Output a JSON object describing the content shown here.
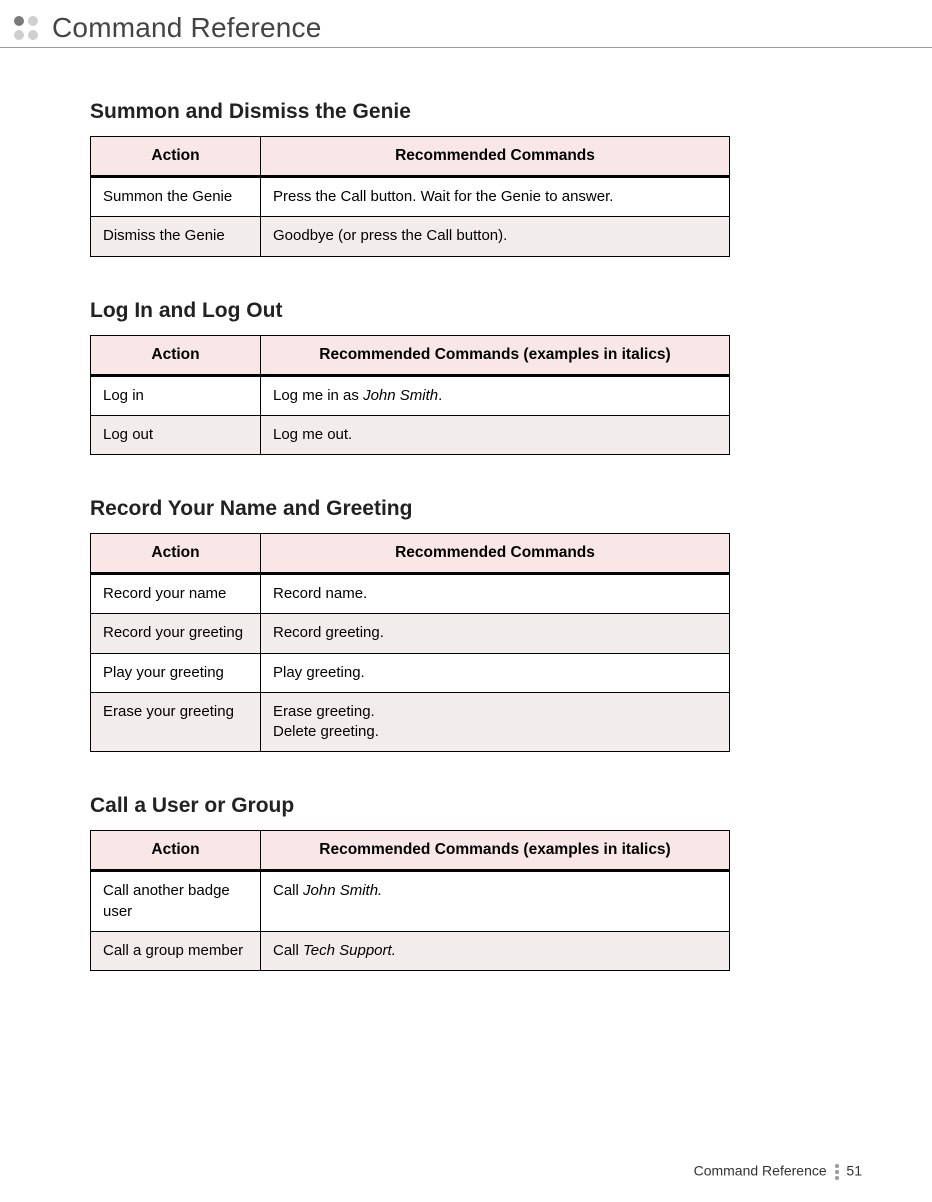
{
  "header": {
    "title": "Command Reference"
  },
  "sections": [
    {
      "title": "Summon and Dismiss the Genie",
      "col_action": "Action",
      "col_cmd": "Recommended Commands",
      "rows": [
        {
          "action": "Summon the Genie",
          "cmd": "Press the Call button. Wait for the Genie to answer."
        },
        {
          "action": "Dismiss the Genie",
          "cmd": "Goodbye (or press the Call button)."
        }
      ]
    },
    {
      "title": "Log In and Log Out",
      "col_action": "Action",
      "col_cmd": "Recommended Commands (examples in italics)",
      "rows": [
        {
          "action": "Log in",
          "cmd_pre": "Log me in as ",
          "cmd_em": "John Smith",
          "cmd_post": "."
        },
        {
          "action": "Log out",
          "cmd": "Log me out."
        }
      ]
    },
    {
      "title": "Record Your Name and Greeting",
      "col_action": "Action",
      "col_cmd": "Recommended Commands",
      "rows": [
        {
          "action": "Record your name",
          "cmd": "Record name."
        },
        {
          "action": "Record your greeting",
          "cmd": "Record greeting."
        },
        {
          "action": "Play your greeting",
          "cmd": "Play greeting."
        },
        {
          "action": "Erase your greeting",
          "cmd": "Erase greeting.\nDelete greeting."
        }
      ]
    },
    {
      "title": "Call a User or Group",
      "col_action": "Action",
      "col_cmd": "Recommended Commands (examples in italics)",
      "rows": [
        {
          "action": "Call another badge user",
          "cmd_pre": "Call ",
          "cmd_em": "John Smith."
        },
        {
          "action": "Call a group member",
          "cmd_pre": "Call ",
          "cmd_em": "Tech Support."
        }
      ]
    }
  ],
  "footer": {
    "label": "Command Reference",
    "page": "51"
  }
}
